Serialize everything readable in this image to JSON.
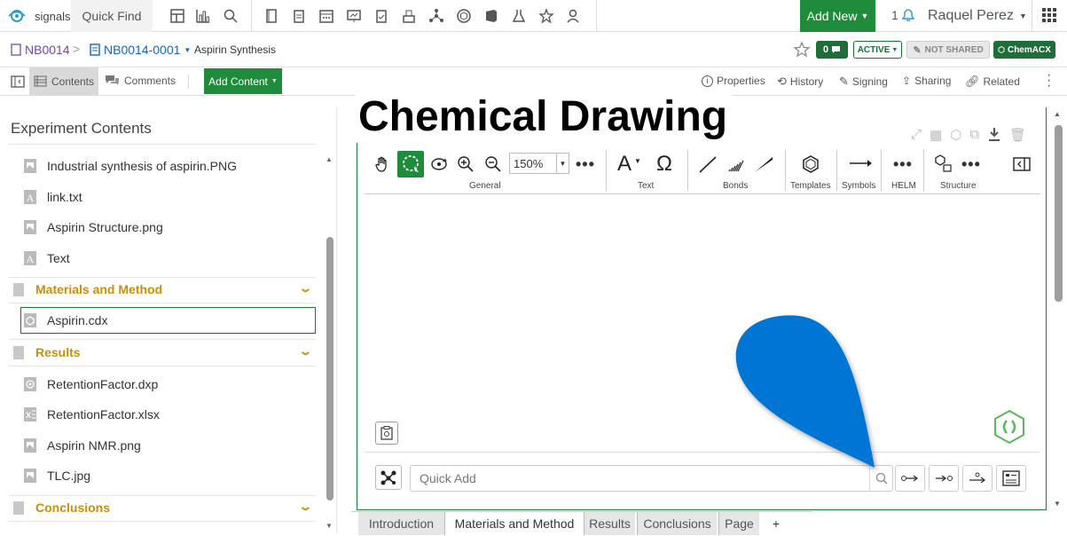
{
  "app": {
    "logo_text": "signals",
    "quick_find": "Quick Find"
  },
  "topbar": {
    "add_new": "Add New",
    "notif_count": "1",
    "user": "Raquel Perez"
  },
  "breadcrumb": {
    "notebook": "NB0014",
    "experiment": "NB0014-0001",
    "title": "Aspirin Synthesis"
  },
  "badges": {
    "comments": "0",
    "status": "ACTIVE",
    "shared": "NOT SHARED",
    "chemacx": "ChemACX"
  },
  "toolbar2": {
    "contents": "Contents",
    "comments": "Comments",
    "add_content": "Add Content",
    "properties": "Properties",
    "history": "History",
    "signing": "Signing",
    "sharing": "Sharing",
    "related": "Related"
  },
  "sidebar": {
    "title": "Experiment Contents",
    "items_top": [
      "Industrial synthesis of aspirin.PNG",
      "link.txt",
      "Aspirin Structure.png",
      "Text"
    ],
    "section_materials": "Materials and Method",
    "materials_items": [
      "Aspirin.cdx"
    ],
    "section_results": "Results",
    "results_items": [
      "RetentionFactor.dxp",
      "RetentionFactor.xlsx",
      "Aspirin NMR.png",
      "TLC.jpg"
    ],
    "section_conclusions": "Conclusions"
  },
  "drawing": {
    "title": "Chemical Drawing",
    "zoom": "150%",
    "groups": {
      "general": "General",
      "text": "Text",
      "bonds": "Bonds",
      "templates": "Templates",
      "symbols": "Symbols",
      "helm": "HELM",
      "structure": "Structure"
    },
    "quick_add_placeholder": "Quick Add"
  },
  "bottom_tabs": [
    "Introduction",
    "Materials and Method",
    "Results",
    "Conclusions",
    "Page",
    "+"
  ],
  "colors": {
    "green": "#1f8c3b",
    "gold": "#c98f0b",
    "blue": "#1565c0",
    "callout": "#0074d4"
  }
}
